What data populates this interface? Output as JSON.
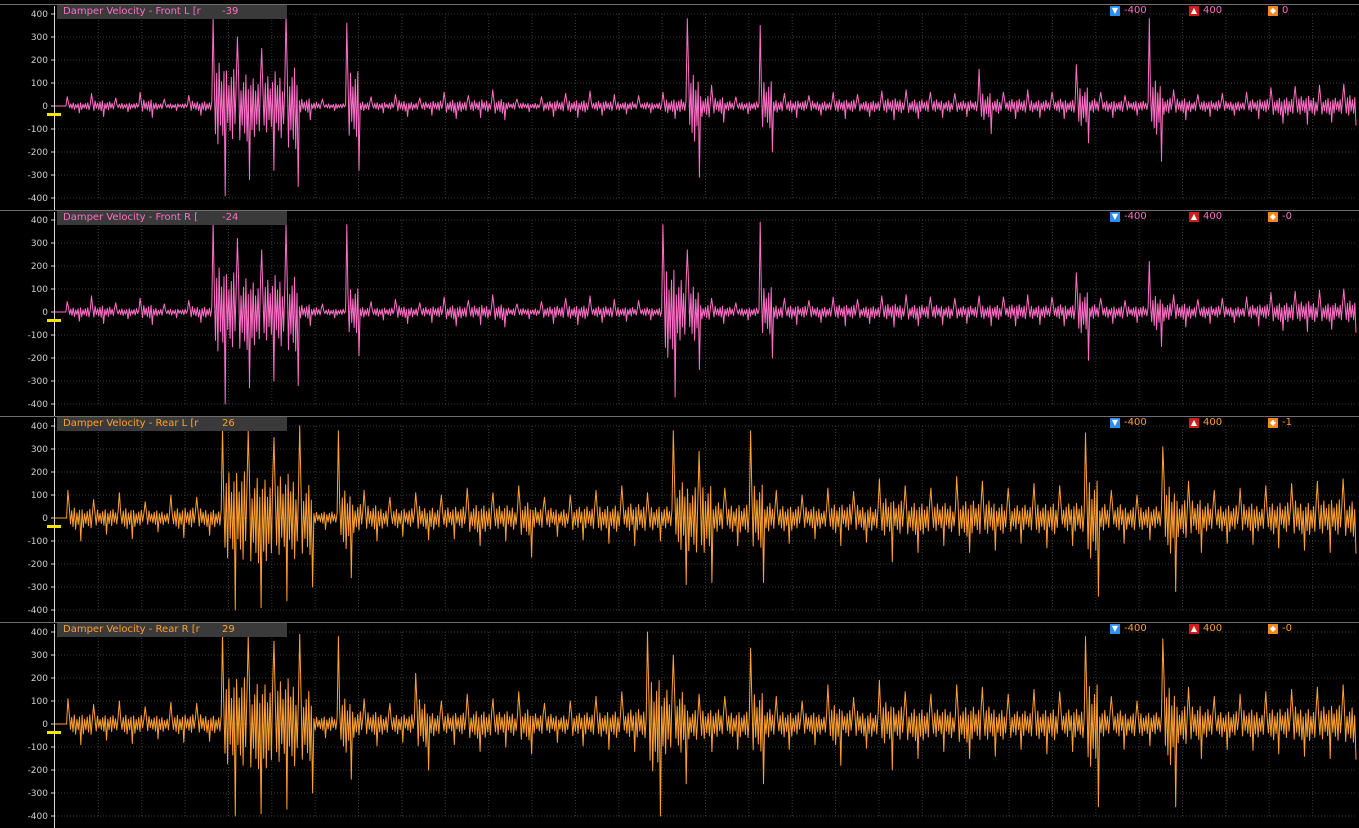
{
  "chart_data": [
    {
      "type": "line",
      "title": "Damper Velocity - Front L [r",
      "cursor_value": "-39",
      "min_label": "-400",
      "max_label": "400",
      "offset_label": "0",
      "color": "#ff6ec7",
      "ylim": [
        -400,
        400
      ],
      "yticks": [
        400,
        300,
        200,
        100,
        0,
        -100,
        -200,
        -300,
        -400
      ],
      "grid": true,
      "series": [
        {
          "values": [
            0,
            40,
            -30,
            55,
            -45,
            35,
            -25,
            60,
            -50,
            30,
            -20,
            45,
            -40,
            380,
            -390,
            300,
            -320,
            250,
            -280,
            400,
            -350,
            -60,
            30,
            -20,
            360,
            -280,
            40,
            -30,
            50,
            -45,
            35,
            -40,
            60,
            -55,
            45,
            -50,
            70,
            -60,
            30,
            -25,
            40,
            -45,
            55,
            -50,
            65,
            -40,
            50,
            -35,
            45,
            -30,
            60,
            -55,
            380,
            -310,
            90,
            -70,
            40,
            -35,
            350,
            -200,
            55,
            -50,
            45,
            -40,
            60,
            -55,
            50,
            -45,
            65,
            -60,
            70,
            -55,
            60,
            -50,
            55,
            -45,
            160,
            -120,
            60,
            -55,
            70,
            -50,
            60,
            -55,
            180,
            -160,
            60,
            -50,
            45,
            -40,
            380,
            -240,
            70,
            -60,
            50,
            -45,
            55,
            -40,
            60,
            -55,
            80,
            -75,
            85,
            -80,
            90,
            -70,
            95,
            -85
          ]
        }
      ]
    },
    {
      "type": "line",
      "title": "Damper Velocity - Front R [",
      "cursor_value": "-24",
      "min_label": "-400",
      "max_label": "400",
      "offset_label": "-0",
      "color": "#ff6ec7",
      "ylim": [
        -400,
        400
      ],
      "yticks": [
        400,
        300,
        200,
        100,
        0,
        -100,
        -200,
        -300,
        -400
      ],
      "grid": true,
      "series": [
        {
          "values": [
            0,
            45,
            -40,
            70,
            -50,
            40,
            -30,
            60,
            -55,
            35,
            -25,
            50,
            -45,
            390,
            -400,
            320,
            -330,
            270,
            -300,
            380,
            -320,
            -60,
            35,
            -25,
            380,
            -190,
            45,
            -35,
            55,
            -50,
            40,
            -45,
            65,
            -60,
            50,
            -55,
            75,
            -65,
            35,
            -30,
            45,
            -50,
            60,
            -55,
            70,
            -45,
            55,
            -40,
            50,
            -35,
            380,
            -370,
            270,
            -250,
            60,
            -50,
            40,
            -35,
            390,
            -200,
            60,
            -55,
            50,
            -45,
            65,
            -60,
            55,
            -50,
            70,
            -65,
            75,
            -60,
            65,
            -55,
            60,
            -50,
            70,
            -60,
            65,
            -60,
            75,
            -55,
            65,
            -60,
            170,
            -210,
            60,
            -50,
            50,
            -45,
            220,
            -150,
            75,
            -65,
            55,
            -50,
            60,
            -45,
            65,
            -60,
            85,
            -80,
            90,
            -85,
            95,
            -75,
            100,
            -90
          ]
        }
      ]
    },
    {
      "type": "line",
      "title": "Damper Velocity - Rear L [r",
      "cursor_value": "26",
      "min_label": "-400",
      "max_label": "400",
      "offset_label": "-1",
      "color": "#ffa030",
      "ylim": [
        -400,
        400
      ],
      "yticks": [
        400,
        300,
        200,
        100,
        0,
        -100,
        -200,
        -300,
        -400
      ],
      "grid": true,
      "series": [
        {
          "values": [
            0,
            120,
            -100,
            80,
            -70,
            110,
            -90,
            70,
            -60,
            100,
            -85,
            90,
            -75,
            400,
            -400,
            380,
            -390,
            350,
            -360,
            400,
            -300,
            -50,
            380,
            -260,
            120,
            -100,
            90,
            -80,
            110,
            -95,
            100,
            -90,
            130,
            -120,
            110,
            -100,
            140,
            -170,
            90,
            -80,
            100,
            -95,
            120,
            -110,
            140,
            -120,
            110,
            -100,
            380,
            -290,
            290,
            -280,
            130,
            -120,
            380,
            -280,
            120,
            -110,
            100,
            -90,
            130,
            -120,
            115,
            -105,
            170,
            -190,
            140,
            -150,
            130,
            -120,
            180,
            -150,
            160,
            -140,
            130,
            -110,
            150,
            -130,
            140,
            -120,
            370,
            -340,
            120,
            -110,
            100,
            -95,
            310,
            -320,
            160,
            -150,
            120,
            -110,
            130,
            -115,
            140,
            -130,
            150,
            -140,
            160,
            -150,
            170,
            -155
          ]
        }
      ]
    },
    {
      "type": "line",
      "title": "Damper Velocity - Rear R [r",
      "cursor_value": "29",
      "min_label": "-400",
      "max_label": "400",
      "offset_label": "-0",
      "color": "#ffa030",
      "ylim": [
        -400,
        400
      ],
      "yticks": [
        400,
        300,
        200,
        100,
        0,
        -100,
        -200,
        -300,
        -400
      ],
      "grid": true,
      "series": [
        {
          "values": [
            0,
            110,
            -90,
            85,
            -70,
            100,
            -85,
            75,
            -65,
            95,
            -80,
            90,
            -75,
            400,
            -400,
            380,
            -390,
            360,
            -370,
            390,
            -300,
            -60,
            380,
            -240,
            110,
            -95,
            90,
            -80,
            220,
            -200,
            100,
            -90,
            130,
            -120,
            110,
            -100,
            140,
            -130,
            90,
            -80,
            100,
            -95,
            120,
            -110,
            140,
            -120,
            400,
            -400,
            300,
            -260,
            130,
            -120,
            120,
            -110,
            330,
            -260,
            120,
            -110,
            100,
            -90,
            170,
            -180,
            115,
            -105,
            190,
            -200,
            140,
            -150,
            130,
            -120,
            170,
            -150,
            160,
            -140,
            130,
            -110,
            150,
            -130,
            140,
            -120,
            380,
            -360,
            120,
            -110,
            100,
            -95,
            370,
            -360,
            160,
            -150,
            120,
            -110,
            130,
            -115,
            140,
            -130,
            150,
            -140,
            160,
            -150,
            170,
            -155
          ]
        }
      ]
    }
  ]
}
